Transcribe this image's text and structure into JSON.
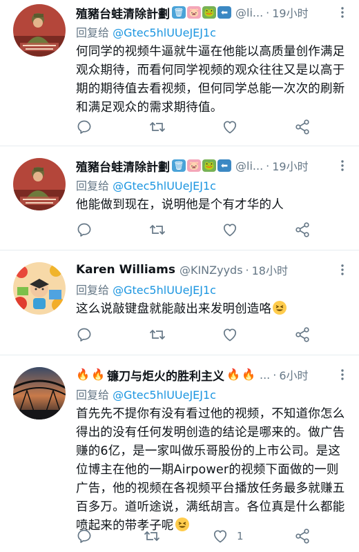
{
  "tweets": [
    {
      "name": "殖豬台蛙清除計劃",
      "handle": "@li...",
      "dot": "·",
      "time": "19小时",
      "reply_prefix": "回复给",
      "reply_to": "@Gtec5hlUUeJEJ1c",
      "text": "何同学的视频牛逼就牛逼在他能以高质量创作满足观众期待，而看何同学视频的观众往往又是以高于期的期待值去看视频，但何同学总能一次次的刷新和满足观众的需求期待值。",
      "emojis": [
        "wastebasket",
        "pig",
        "frog",
        "left-arrow"
      ]
    },
    {
      "name": "殖豬台蛙清除計劃",
      "handle": "@li...",
      "dot": "·",
      "time": "19小时",
      "reply_prefix": "回复给",
      "reply_to": "@Gtec5hlUUeJEJ1c",
      "text": "他能做到现在，说明他是个有才华的人",
      "emojis": [
        "wastebasket",
        "pig",
        "frog",
        "left-arrow"
      ]
    },
    {
      "name": "Karen Williams",
      "handle": "@KINZyyds",
      "dot": "·",
      "time": "18小时",
      "reply_prefix": "回复给",
      "reply_to": "@Gtec5hlUUeJEJ1c",
      "text": "这么说敲键盘就能敲出来发明创造咯",
      "emojis": []
    },
    {
      "name": "镰刀与炬火的胜利主义",
      "handle": "...",
      "dot": "·",
      "time": "6小时",
      "reply_prefix": "回复给",
      "reply_to": "@Gtec5hlUUeJEJ1c",
      "text": "首先先不提你有没有看过他的视频，不知道你怎么得出的没有任何发明创造的结论是哪来的。做广告赚的6亿，是一家叫做乐哥股份的上市公司。是这位博主在他的一期Airpower的视频下面做的一则广告，他的视频在各视频平台播放任务最多就赚五百多万。道听途说，满纸胡言。各位真是什么都能喷起来的带孝子呢",
      "like_count": "1",
      "emojis": [
        "fire",
        "fire"
      ]
    }
  ],
  "colors": {
    "name": "#0f1419",
    "secondary": "#657786",
    "mention": "#1b95e0",
    "divider": "#e6ecf0"
  },
  "icons": [
    "reply-icon",
    "retweet-icon",
    "like-icon",
    "share-icon",
    "more-icon",
    "grinning-squinting-face"
  ]
}
